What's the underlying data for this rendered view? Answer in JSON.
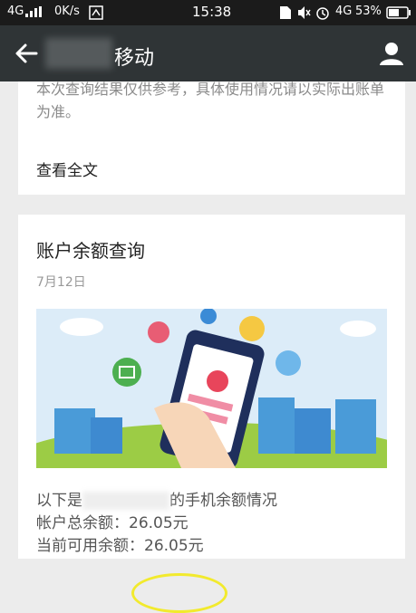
{
  "status_bar": {
    "network_left": "4G",
    "speed": "0K/s",
    "time": "15:38",
    "network_right": "4G",
    "battery": "53%"
  },
  "app_bar": {
    "title": "移动"
  },
  "article_card": {
    "text": "本次查询结果仅供参考，具体使用情况请以实际出账单为准。",
    "read_all": "查看全文"
  },
  "balance_card": {
    "title": "账户余额查询",
    "date": "7月12日",
    "line1_prefix": "以下是",
    "line1_suffix": "的手机余额情况",
    "line2_label": "帐户总余额：",
    "line2_value": "26.05元",
    "line3_label": "当前可用余额：",
    "line3_value": "26.05元"
  },
  "colors": {
    "status_bar_bg": "#1b1b1b",
    "app_bar_bg": "#2f3436",
    "highlight": "#f2ea2d"
  }
}
